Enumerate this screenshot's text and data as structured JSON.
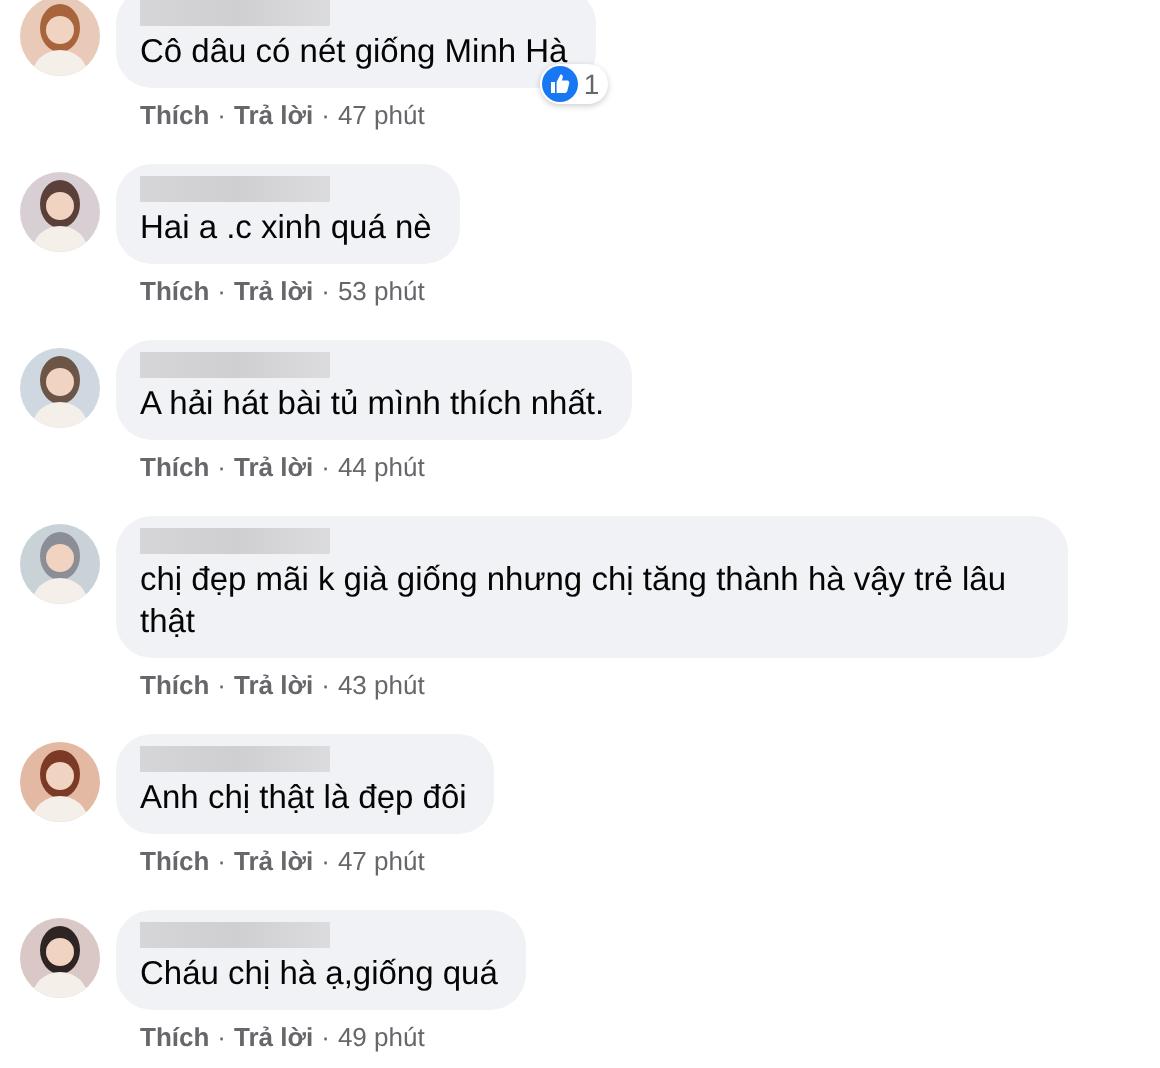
{
  "separator": "·",
  "comments": [
    {
      "text": "Cô dâu có nét giống Minh Hà",
      "like": "Thích",
      "reply": "Trả lời",
      "time": "47 phút",
      "reactions": {
        "count": "1"
      }
    },
    {
      "text": "Hai a .c xinh quá nè",
      "like": "Thích",
      "reply": "Trả lời",
      "time": "53 phút"
    },
    {
      "text": "A hải hát bài tủ mình thích nhất.",
      "like": "Thích",
      "reply": "Trả lời",
      "time": "44 phút"
    },
    {
      "text": "chị đẹp mãi k già giống nhưng chị tăng thành hà vậy trẻ lâu thật",
      "like": "Thích",
      "reply": "Trả lời",
      "time": "43 phút"
    },
    {
      "text": "Anh chị thật là đẹp đôi",
      "like": "Thích",
      "reply": "Trả lời",
      "time": "47 phút"
    },
    {
      "text": "Cháu chị hà ạ,giống quá",
      "like": "Thích",
      "reply": "Trả lời",
      "time": "49 phút"
    }
  ]
}
